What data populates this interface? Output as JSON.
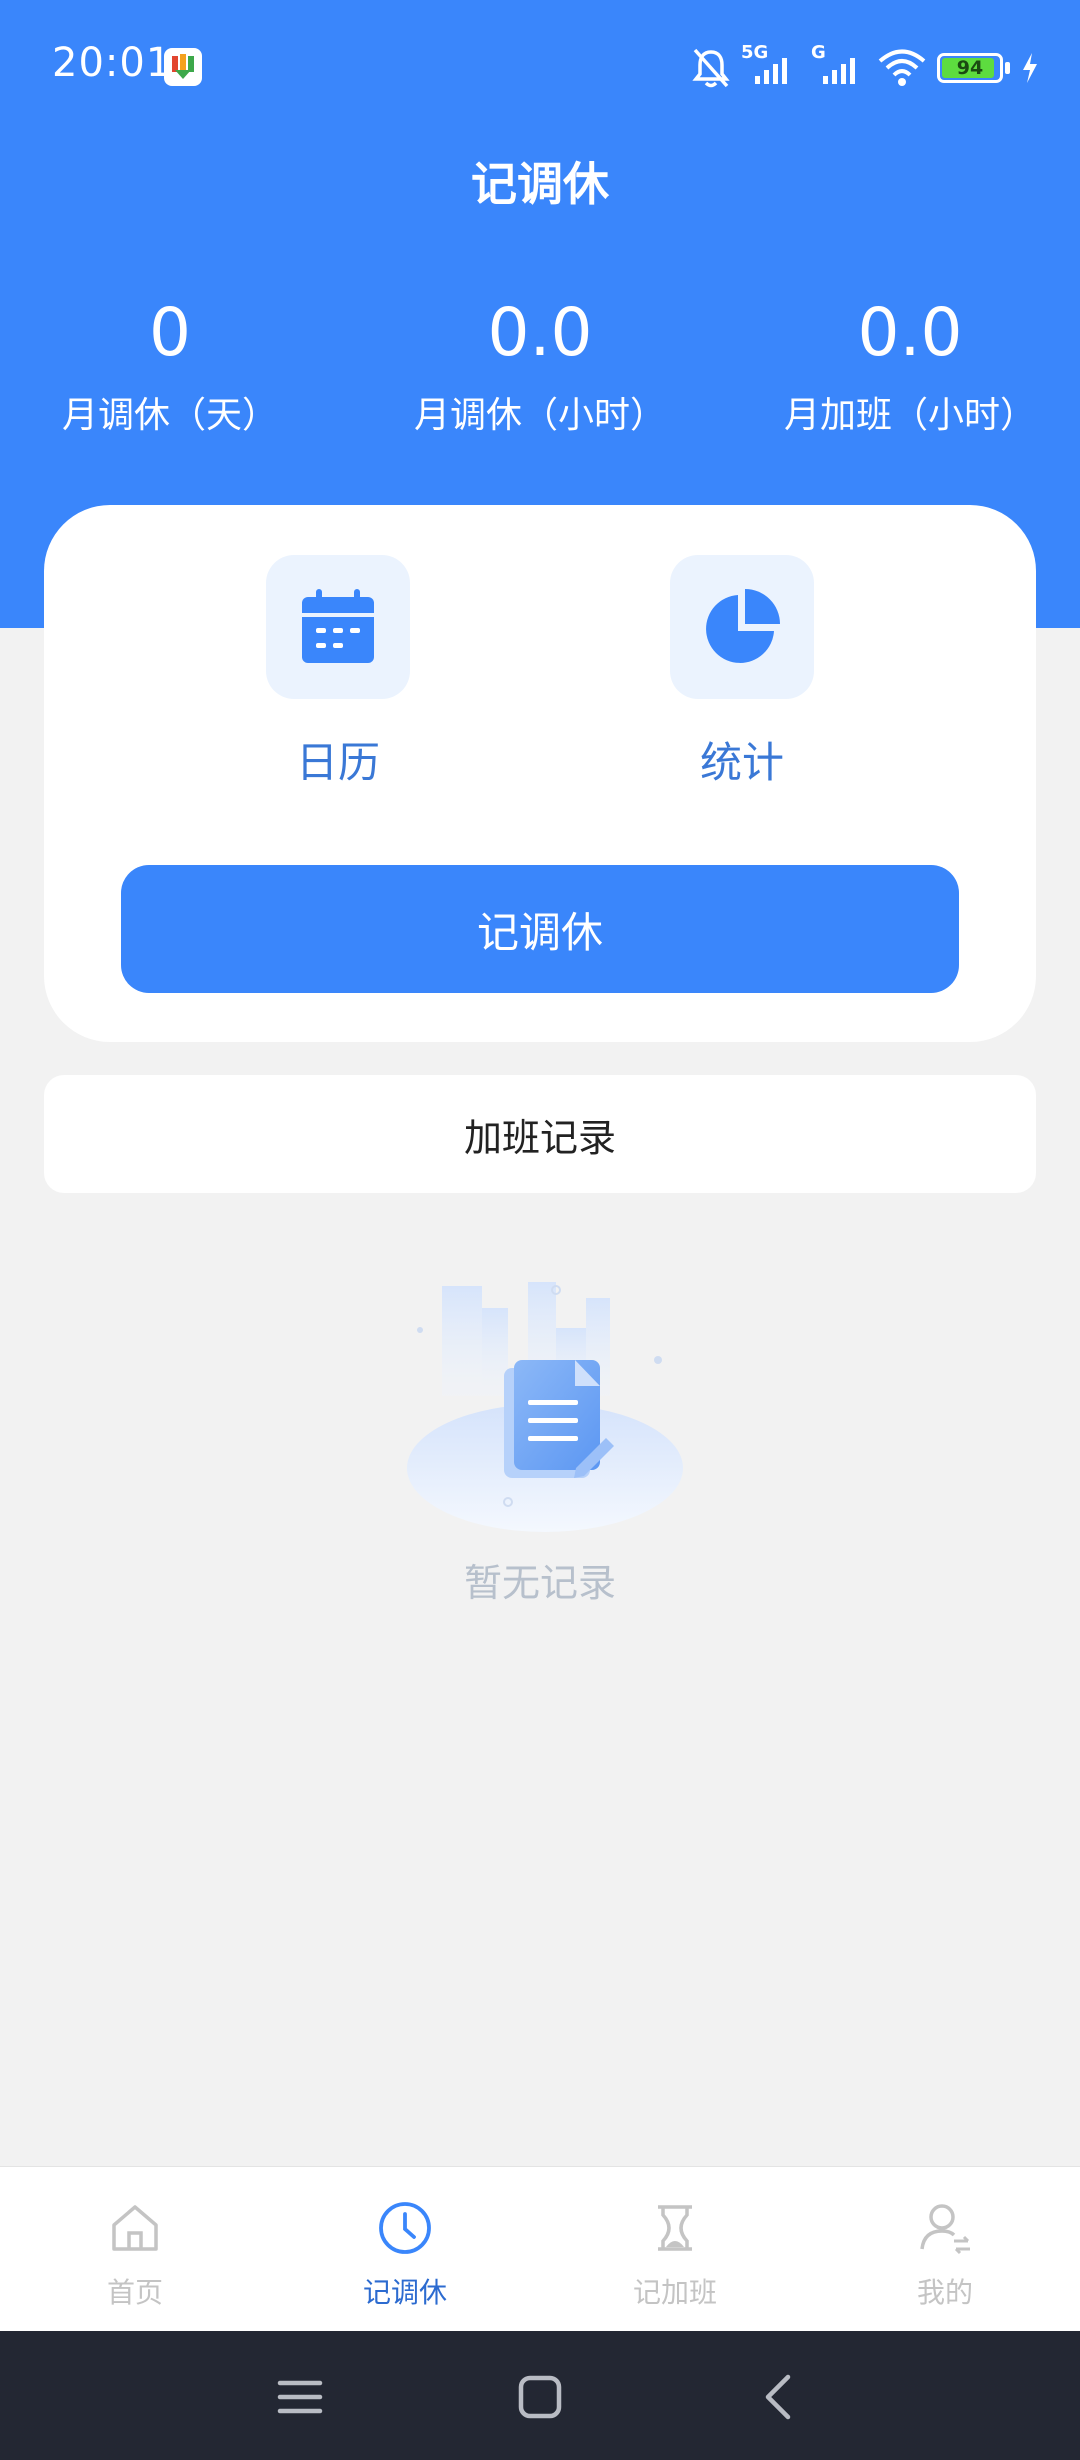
{
  "status_bar": {
    "time": "20:01",
    "network_1": "5G",
    "network_2": "G",
    "battery_percent": 94,
    "battery_label": "94",
    "icons": [
      "app-icon",
      "mute-bell-icon",
      "signal-icon",
      "signal-icon",
      "wifi-icon",
      "battery-icon",
      "charging-icon"
    ]
  },
  "header": {
    "title": "记调休"
  },
  "stats": [
    {
      "value": "0",
      "label": "月调休（天）"
    },
    {
      "value": "0.0",
      "label": "月调休（小时）"
    },
    {
      "value": "0.0",
      "label": "月加班（小时）"
    }
  ],
  "features": [
    {
      "label": "日历",
      "icon": "calendar-icon"
    },
    {
      "label": "统计",
      "icon": "pie-chart-icon"
    }
  ],
  "primary_button": {
    "label": "记调休"
  },
  "records": {
    "title": "加班记录"
  },
  "empty": {
    "text": "暂无记录",
    "icon": "empty-document-illustration"
  },
  "bottom_nav": {
    "items": [
      {
        "label": "首页",
        "icon": "home-icon",
        "active": false
      },
      {
        "label": "记调休",
        "icon": "clock-icon",
        "active": true
      },
      {
        "label": "记加班",
        "icon": "hourglass-icon",
        "active": false
      },
      {
        "label": "我的",
        "icon": "user-icon",
        "active": false
      }
    ]
  },
  "system_nav": {
    "icons": [
      "menu-icon",
      "home-square-icon",
      "back-icon"
    ]
  },
  "colors": {
    "primary": "#3a86fb",
    "active_nav": "#2c6bd0",
    "inactive_nav": "#c4c4c4",
    "background": "#f2f2f2"
  }
}
